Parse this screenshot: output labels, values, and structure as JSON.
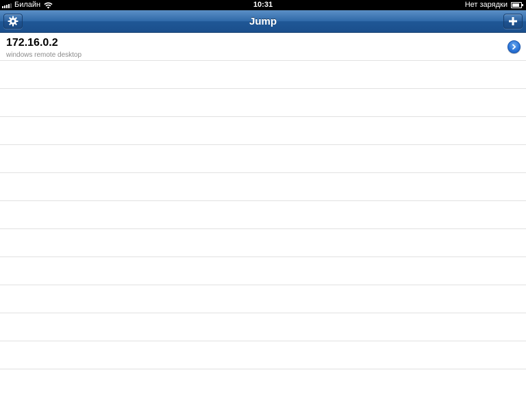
{
  "status_bar": {
    "carrier": "Билайн",
    "time": "10:31",
    "charging_status": "Нет зарядки",
    "signal_icon": "signal-bars-icon",
    "wifi_icon": "wifi-icon",
    "battery_icon": "battery-icon",
    "battery_level_percent": 85
  },
  "nav_bar": {
    "title": "Jump",
    "left_button_icon": "gear-icon",
    "right_button_icon": "plus-icon"
  },
  "connections": [
    {
      "name": "172.16.0.2",
      "type": "windows remote desktop",
      "accessory_icon": "disclosure-arrow-icon"
    }
  ],
  "colors": {
    "nav_bar": "#2f69a8",
    "status_bar": "#000000",
    "row_separator": "#e1e1e1",
    "subtitle_text": "#8a8a8a",
    "disclosure_button": "#2a73d6"
  }
}
